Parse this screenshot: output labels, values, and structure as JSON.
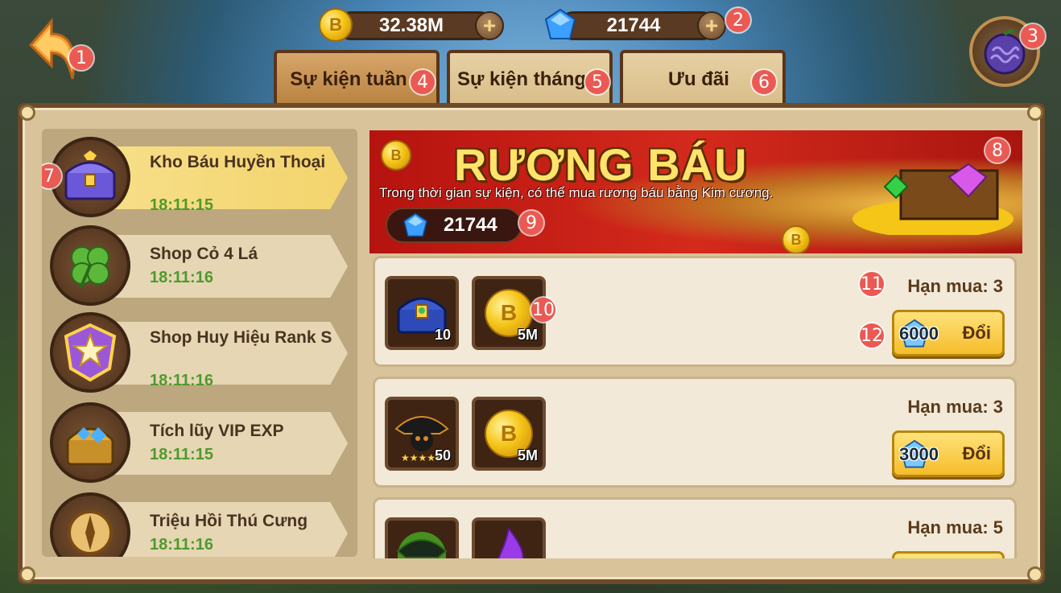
{
  "header": {
    "gold": "32.38M",
    "gems": "21744",
    "gold_icon": "B",
    "back_icon": "back-arrow-icon",
    "fruit_icon": "devil-fruit-icon"
  },
  "tabs": [
    {
      "label": "Sự kiện tuần",
      "active": true
    },
    {
      "label": "Sự kiện tháng",
      "active": false
    },
    {
      "label": "Ưu đãi",
      "active": false
    }
  ],
  "sidebar": {
    "items": [
      {
        "name": "Kho Báu Huyền Thoại",
        "time": "18:11:15",
        "icon": "legend-chest-icon",
        "active": true
      },
      {
        "name": "Shop Cỏ 4 Lá",
        "time": "18:11:16",
        "icon": "four-leaf-clover-icon",
        "active": false
      },
      {
        "name": "Shop Huy Hiệu Rank S",
        "time": "18:11:16",
        "icon": "rank-badge-icon",
        "active": false
      },
      {
        "name": "Tích lũy VIP EXP",
        "time": "18:11:15",
        "icon": "gem-chest-icon",
        "active": false
      },
      {
        "name": "Triệu Hồi Thú Cưng",
        "time": "18:11:16",
        "icon": "compass-icon",
        "active": false
      }
    ]
  },
  "banner": {
    "title": "RƯƠNG BÁU",
    "description": "Trong thời gian sự kiện, có thể mua rương báu bằng Kim cương.",
    "gems": "21744"
  },
  "offers": [
    {
      "limit": "Hạn mua: 3",
      "price": "6000",
      "button": "Đổi",
      "items": [
        {
          "icon": "treasure-chest-icon",
          "qty": "10"
        },
        {
          "icon": "gold-coin-icon",
          "qty": "5M"
        }
      ]
    },
    {
      "limit": "Hạn mua: 3",
      "price": "3000",
      "button": "Đổi",
      "items": [
        {
          "icon": "pirate-skull-icon",
          "qty": "50"
        },
        {
          "icon": "gold-coin-icon",
          "qty": "5M"
        }
      ]
    },
    {
      "limit": "Hạn mua: 5",
      "price": "",
      "button": "",
      "items": [
        {
          "icon": "green-pirate-hat-icon",
          "qty": ""
        },
        {
          "icon": "purple-flame-icon",
          "qty": ""
        }
      ]
    }
  ],
  "markers": [
    "1",
    "2",
    "3",
    "4",
    "5",
    "6",
    "7",
    "8",
    "9",
    "10",
    "11",
    "12"
  ]
}
